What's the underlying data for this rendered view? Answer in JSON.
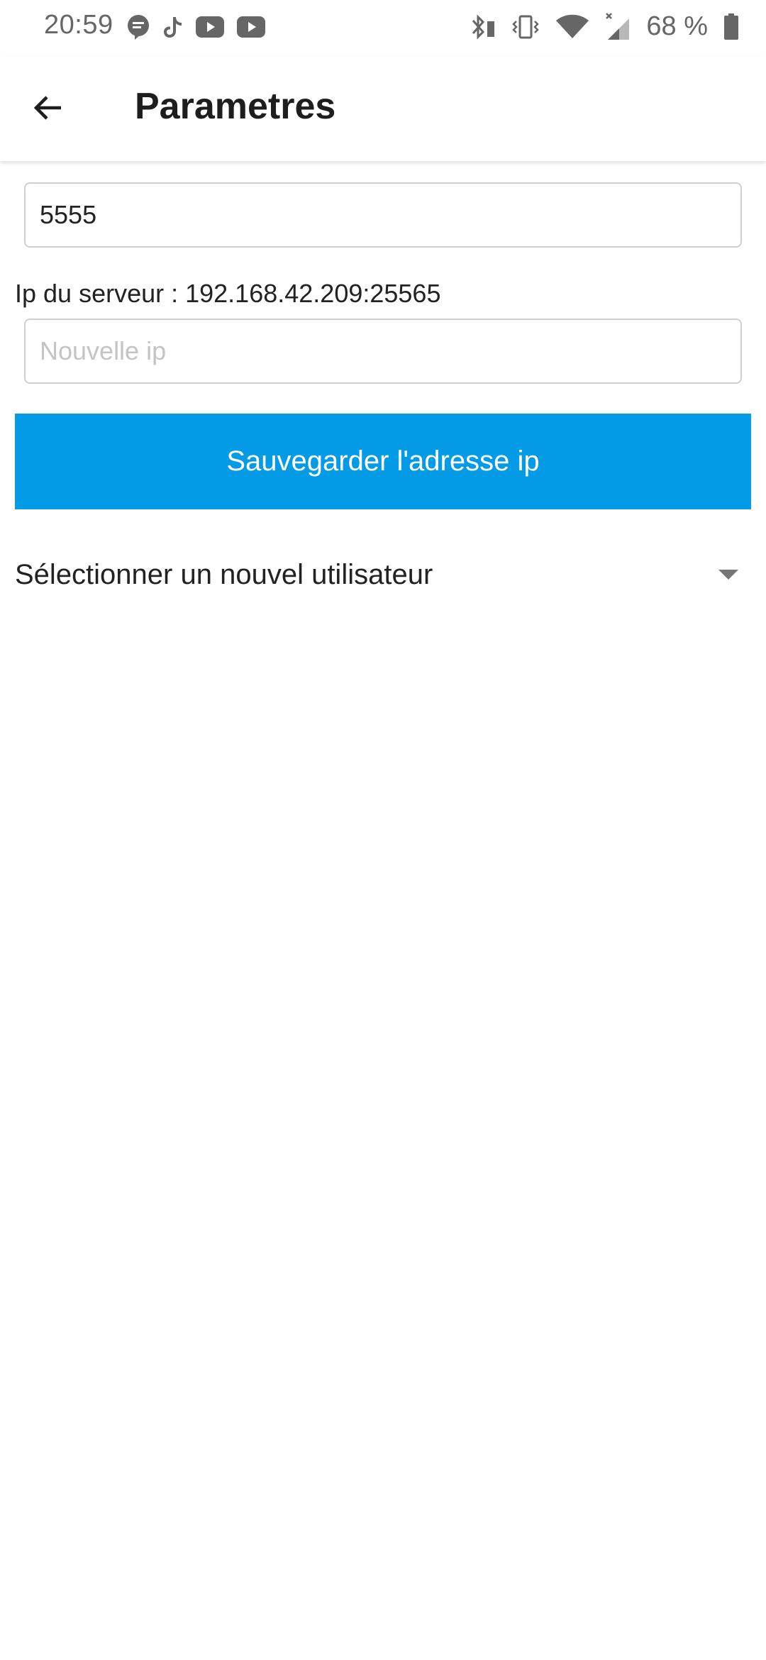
{
  "status_bar": {
    "time": "20:59",
    "battery_text": "68 %",
    "left_icons": [
      "chat-bubble-icon",
      "tiktok-icon",
      "youtube-icon",
      "youtube-icon"
    ],
    "right_icons": [
      "bluetooth-icon",
      "vibrate-icon",
      "wifi-icon",
      "cell-signal-icon",
      "battery-icon"
    ]
  },
  "app_bar": {
    "title": "Parametres",
    "back_icon": "arrow-back-icon"
  },
  "port_field": {
    "value": "5555"
  },
  "server": {
    "label": "Ip du serveur : 192.168.42.209:25565"
  },
  "ip_field": {
    "value": "",
    "placeholder": "Nouvelle ip"
  },
  "save_button": {
    "label": "Sauvegarder l'adresse ip"
  },
  "user_select": {
    "label": "Sélectionner un nouvel utilisateur"
  },
  "colors": {
    "accent": "#039be5",
    "status_text": "#666666",
    "field_border": "#cfcfcf",
    "placeholder": "#c4c4c4"
  }
}
